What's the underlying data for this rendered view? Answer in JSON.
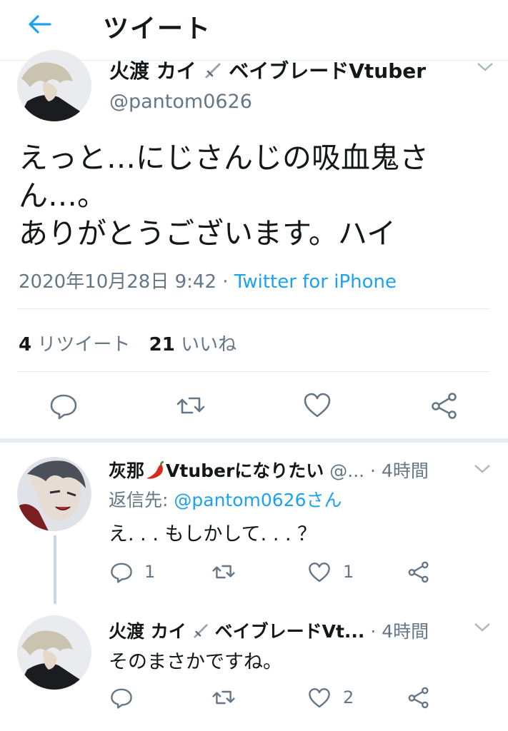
{
  "header": {
    "title": "ツイート"
  },
  "tweet": {
    "display_name": "火渡 カイ",
    "name_suffix": "ベイブレードVtuber",
    "handle": "@pantom0626",
    "text_line1": "えっと…にじさんじの吸血鬼さ",
    "text_line2": "ん…。",
    "text_line3": "ありがとうございます。ハイ",
    "timestamp": "2020年10月28日 9:42",
    "separator": "·",
    "source": "Twitter for iPhone",
    "retweet_count": "4",
    "retweet_label": "リツイート",
    "like_count": "21",
    "like_label": "いいね"
  },
  "replies": [
    {
      "name": "灰那",
      "name_suffix": "Vtuberになりたい",
      "handle": "@...",
      "time": "· 4時間",
      "reply_to_prefix": "返信先:",
      "reply_to_handle": "@pantom0626さん",
      "text": "え. . . もしかして. . . ？",
      "reply_count": "1",
      "like_count": "1"
    },
    {
      "name": "火渡 カイ",
      "name_suffix": "ベイブレードVt...",
      "time": "· 4時間",
      "text": "そのまさかですね。",
      "like_count": "2"
    }
  ],
  "colors": {
    "accent": "#1da1f2",
    "muted": "#657786",
    "text": "#14171a",
    "divider": "#e6ecf0",
    "chili": "#d9281c"
  }
}
